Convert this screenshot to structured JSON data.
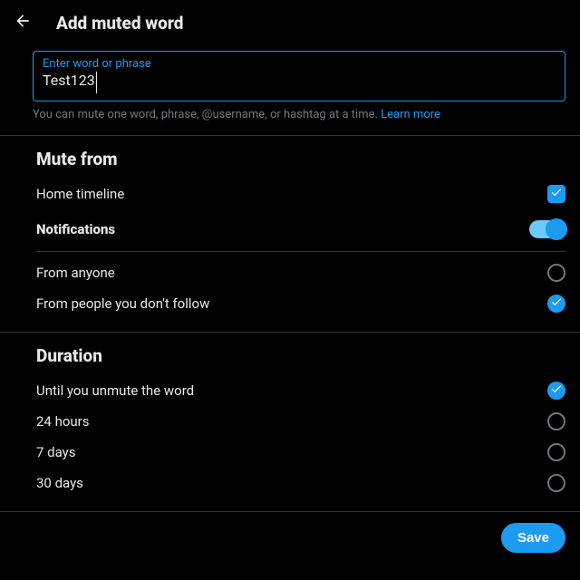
{
  "header": {
    "title": "Add muted word"
  },
  "input": {
    "label": "Enter word or phrase",
    "value": "Test123"
  },
  "helper": {
    "text": "You can mute one word, phrase, @username, or hashtag at a time. ",
    "link": "Learn more"
  },
  "mute_from": {
    "title": "Mute from",
    "home_timeline": "Home timeline",
    "notifications": "Notifications",
    "from_anyone": "From anyone",
    "from_not_follow": "From people you don't follow"
  },
  "duration": {
    "title": "Duration",
    "options": {
      "forever": "Until you unmute the word",
      "h24": "24 hours",
      "d7": "7 days",
      "d30": "30 days"
    }
  },
  "footer": {
    "save": "Save"
  }
}
